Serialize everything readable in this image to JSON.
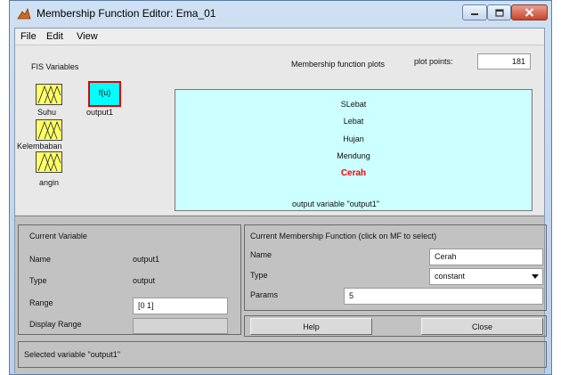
{
  "window": {
    "title": "Membership Function Editor: Ema_01"
  },
  "menu": [
    "File",
    "Edit",
    "View"
  ],
  "fis": {
    "label": "FIS Variables",
    "inputs": [
      "Suhu",
      "Kelembaban",
      "angin"
    ],
    "output_label": "output1",
    "output_box": "f(u)"
  },
  "plot": {
    "title": "Membership function plots",
    "points_label": "plot points:",
    "points_value": "181",
    "functions": [
      "SLebat",
      "Lebat",
      "Hujan",
      "Mendung",
      "Cerah"
    ],
    "selected": "Cerah",
    "caption": "output variable \"output1\""
  },
  "current_variable": {
    "title": "Current Variable",
    "name_label": "Name",
    "name_value": "output1",
    "type_label": "Type",
    "type_value": "output",
    "range_label": "Range",
    "range_value": "[0 1]",
    "display_range_label": "Display Range",
    "display_range_value": ""
  },
  "current_mf": {
    "title": "Current Membership Function (click on MF to select)",
    "name_label": "Name",
    "name_value": "Cerah",
    "type_label": "Type",
    "type_value": "constant",
    "params_label": "Params",
    "params_value": "5"
  },
  "buttons": {
    "help": "Help",
    "close": "Close"
  },
  "status": "Selected variable \"output1\"",
  "colors": {
    "plot_bg": "#ccffff",
    "mf_box": "#ffff66",
    "output_box": "#00ffff",
    "selected_mf": "#ff0000",
    "highlight_border": "#e00000"
  }
}
